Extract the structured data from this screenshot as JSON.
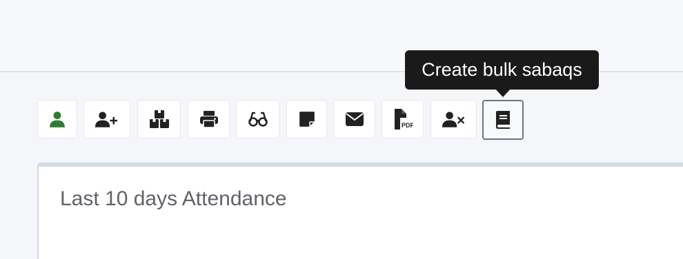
{
  "toolbar": {
    "buttons": [
      {
        "name": "student-button",
        "icon": "user-icon",
        "color": "#2e7d32"
      },
      {
        "name": "add-student-button",
        "icon": "user-plus-icon",
        "color": "#222222"
      },
      {
        "name": "bulk-boxes-button",
        "icon": "boxes-icon",
        "color": "#222222"
      },
      {
        "name": "print-button",
        "icon": "print-icon",
        "color": "#222222"
      },
      {
        "name": "view-button",
        "icon": "glasses-icon",
        "color": "#222222"
      },
      {
        "name": "note-button",
        "icon": "sticky-note-icon",
        "color": "#222222"
      },
      {
        "name": "email-button",
        "icon": "envelope-icon",
        "color": "#222222"
      },
      {
        "name": "pdf-button",
        "icon": "file-pdf-icon",
        "color": "#222222"
      },
      {
        "name": "remove-student-button",
        "icon": "user-xmark-icon",
        "color": "#222222"
      },
      {
        "name": "create-bulk-sabaqs-button",
        "icon": "book-icon",
        "color": "#222222",
        "active": true
      }
    ]
  },
  "tooltip": {
    "text": "Create bulk sabaqs"
  },
  "panel": {
    "title": "Last 10 days Attendance"
  }
}
